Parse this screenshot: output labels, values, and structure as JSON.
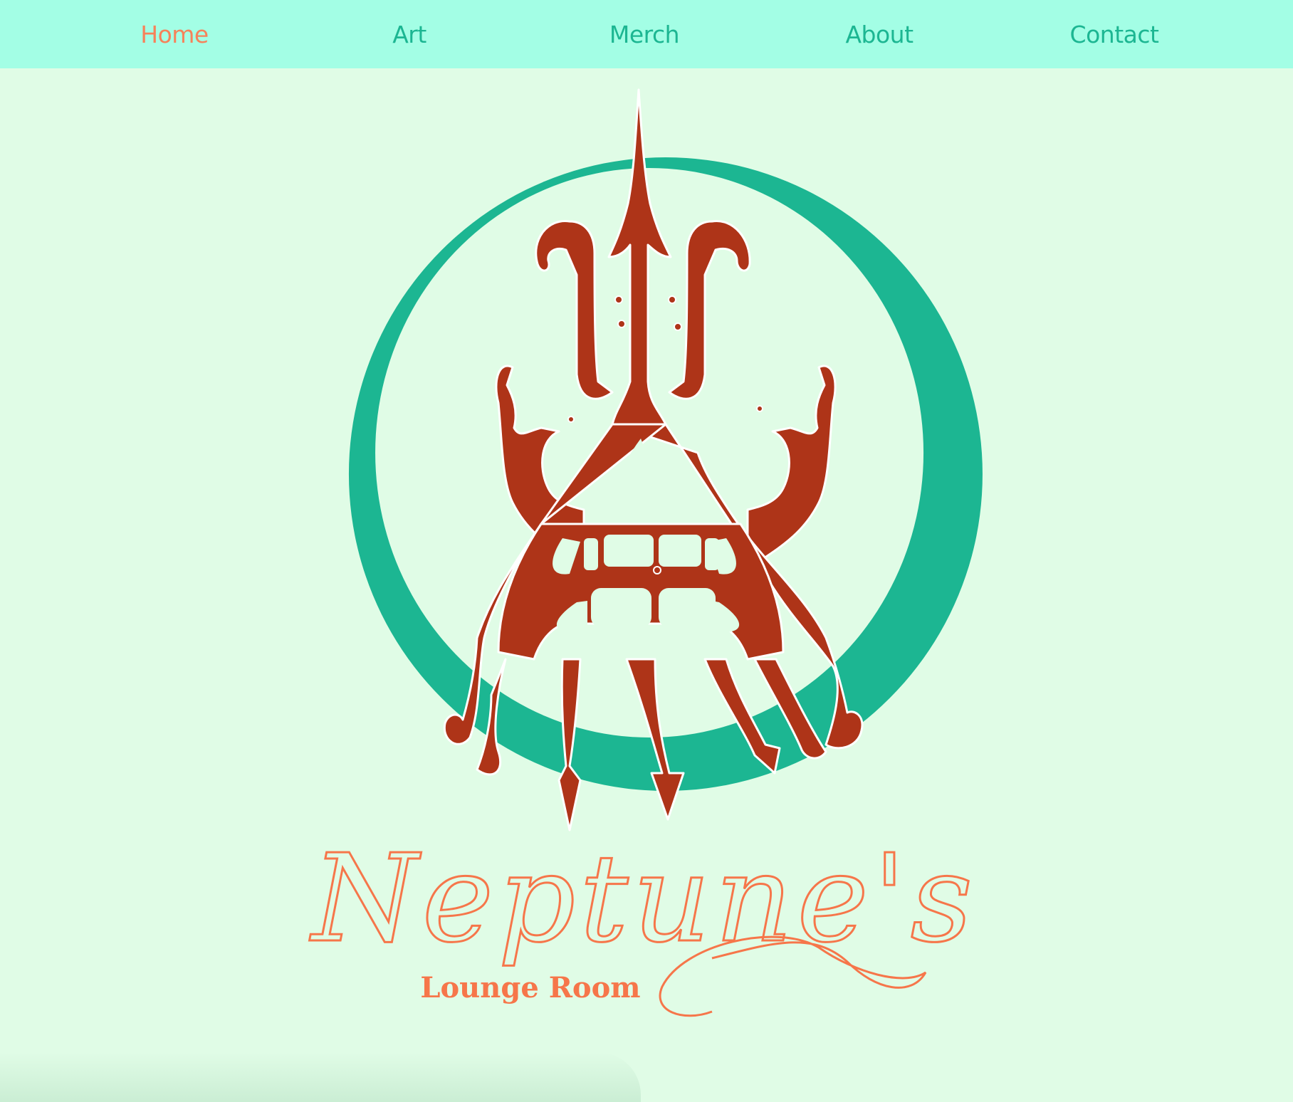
{
  "nav": {
    "items": [
      {
        "label": "Home",
        "active": true
      },
      {
        "label": "Art",
        "active": false
      },
      {
        "label": "Merch",
        "active": false
      },
      {
        "label": "About",
        "active": false
      },
      {
        "label": "Contact",
        "active": false
      }
    ]
  },
  "logo": {
    "wordmark": "Neptune's",
    "tagline": "Lounge Room",
    "emblem_icon": "trident-face-icon"
  },
  "colors": {
    "nav_background": "#a3fee5",
    "page_background": "#e0fce6",
    "nav_text": "#1cb692",
    "nav_active": "#f6825a",
    "ring": "#1cb692",
    "trident": "#ae3418",
    "wordmark": "#f6764a"
  }
}
